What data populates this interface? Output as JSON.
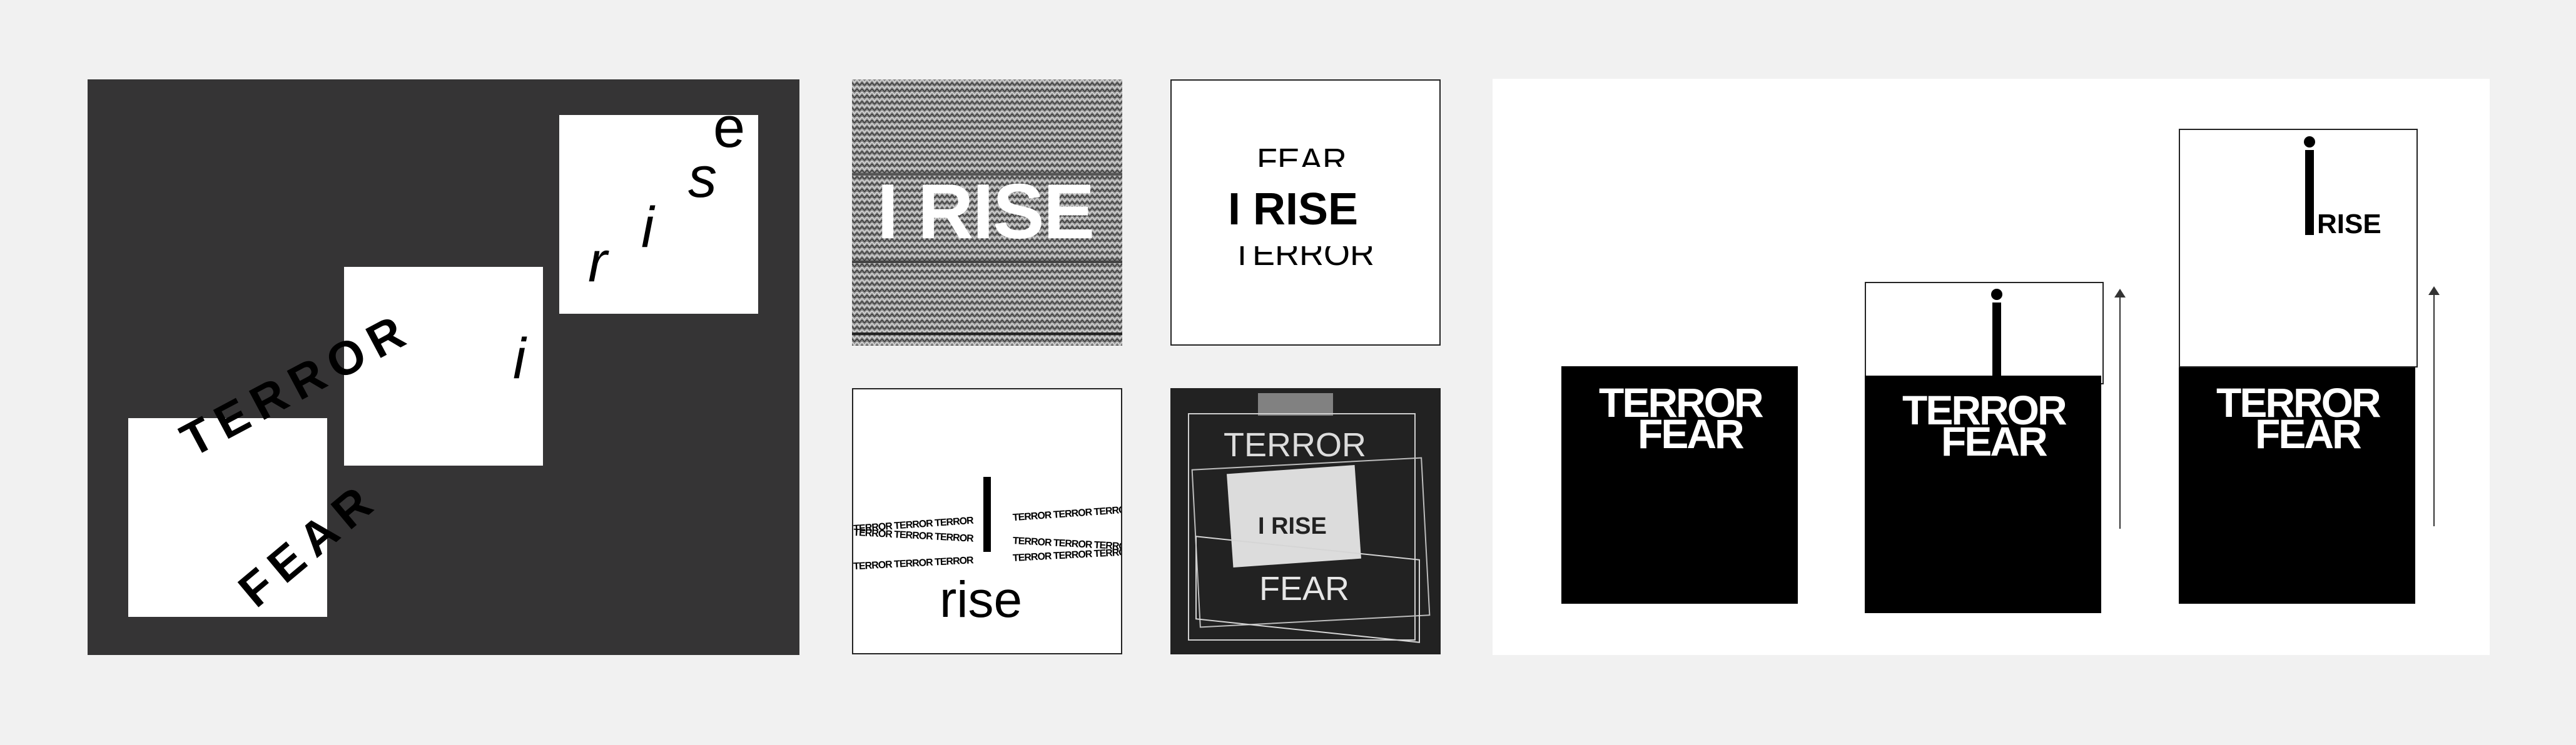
{
  "panel1": {
    "terror": "TERROR",
    "fear": "FEAR",
    "rise_letters": [
      "r",
      "i",
      "s",
      "e"
    ],
    "i_letter": "i"
  },
  "panel2": {
    "text": "I RISE"
  },
  "panel3": {
    "top": "FEAR",
    "middle": "I RISE",
    "bottom": "TERROR"
  },
  "panel4": {
    "tile": "TERROR",
    "rise": "rise"
  },
  "panel5": {
    "terror": "TERROR",
    "middle": "I RISE",
    "fear": "FEAR"
  },
  "panel6": {
    "terror": "TERROR",
    "fear": "FEAR",
    "rise": "RISE",
    "i": "i"
  }
}
